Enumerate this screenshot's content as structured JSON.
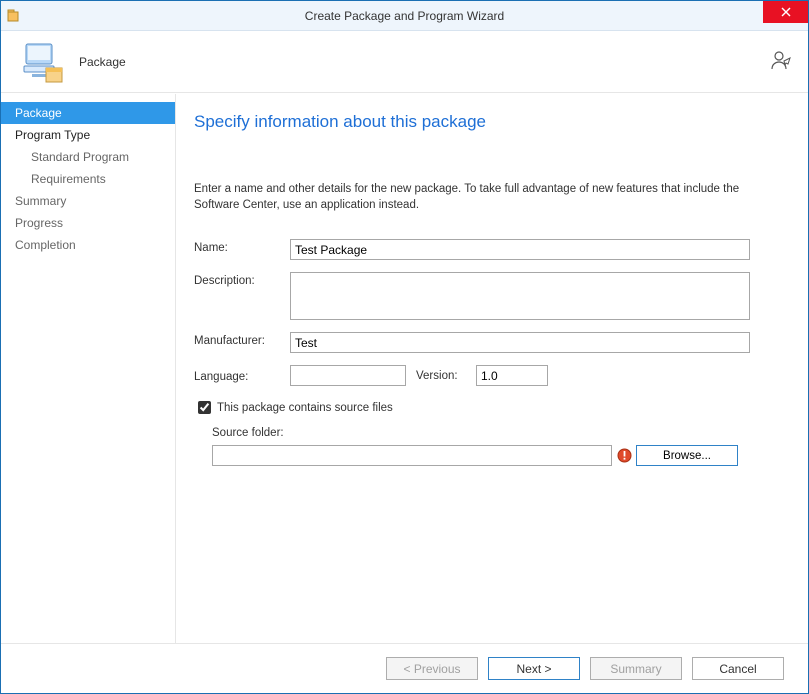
{
  "titlebar": {
    "title": "Create Package and Program Wizard"
  },
  "header": {
    "label": "Package"
  },
  "sidebar": {
    "items": [
      {
        "label": "Package",
        "selected": true
      },
      {
        "label": "Program Type",
        "bold": true
      },
      {
        "label": "Standard Program",
        "sub": true
      },
      {
        "label": "Requirements",
        "sub": true
      },
      {
        "label": "Summary"
      },
      {
        "label": "Progress"
      },
      {
        "label": "Completion"
      }
    ]
  },
  "page": {
    "title": "Specify information about this package",
    "instruction": "Enter a name and other details for the new package. To take full advantage of new features that include the Software Center, use an application instead.",
    "labels": {
      "name": "Name:",
      "description": "Description:",
      "manufacturer": "Manufacturer:",
      "language": "Language:",
      "version": "Version:",
      "contains_source": "This package contains source files",
      "source_folder": "Source folder:",
      "browse": "Browse..."
    },
    "values": {
      "name": "Test Package",
      "description": "",
      "manufacturer": "Test",
      "language": "",
      "version": "1.0",
      "contains_source": true,
      "source_folder": ""
    }
  },
  "footer": {
    "previous": "< Previous",
    "next": "Next >",
    "summary": "Summary",
    "cancel": "Cancel"
  }
}
